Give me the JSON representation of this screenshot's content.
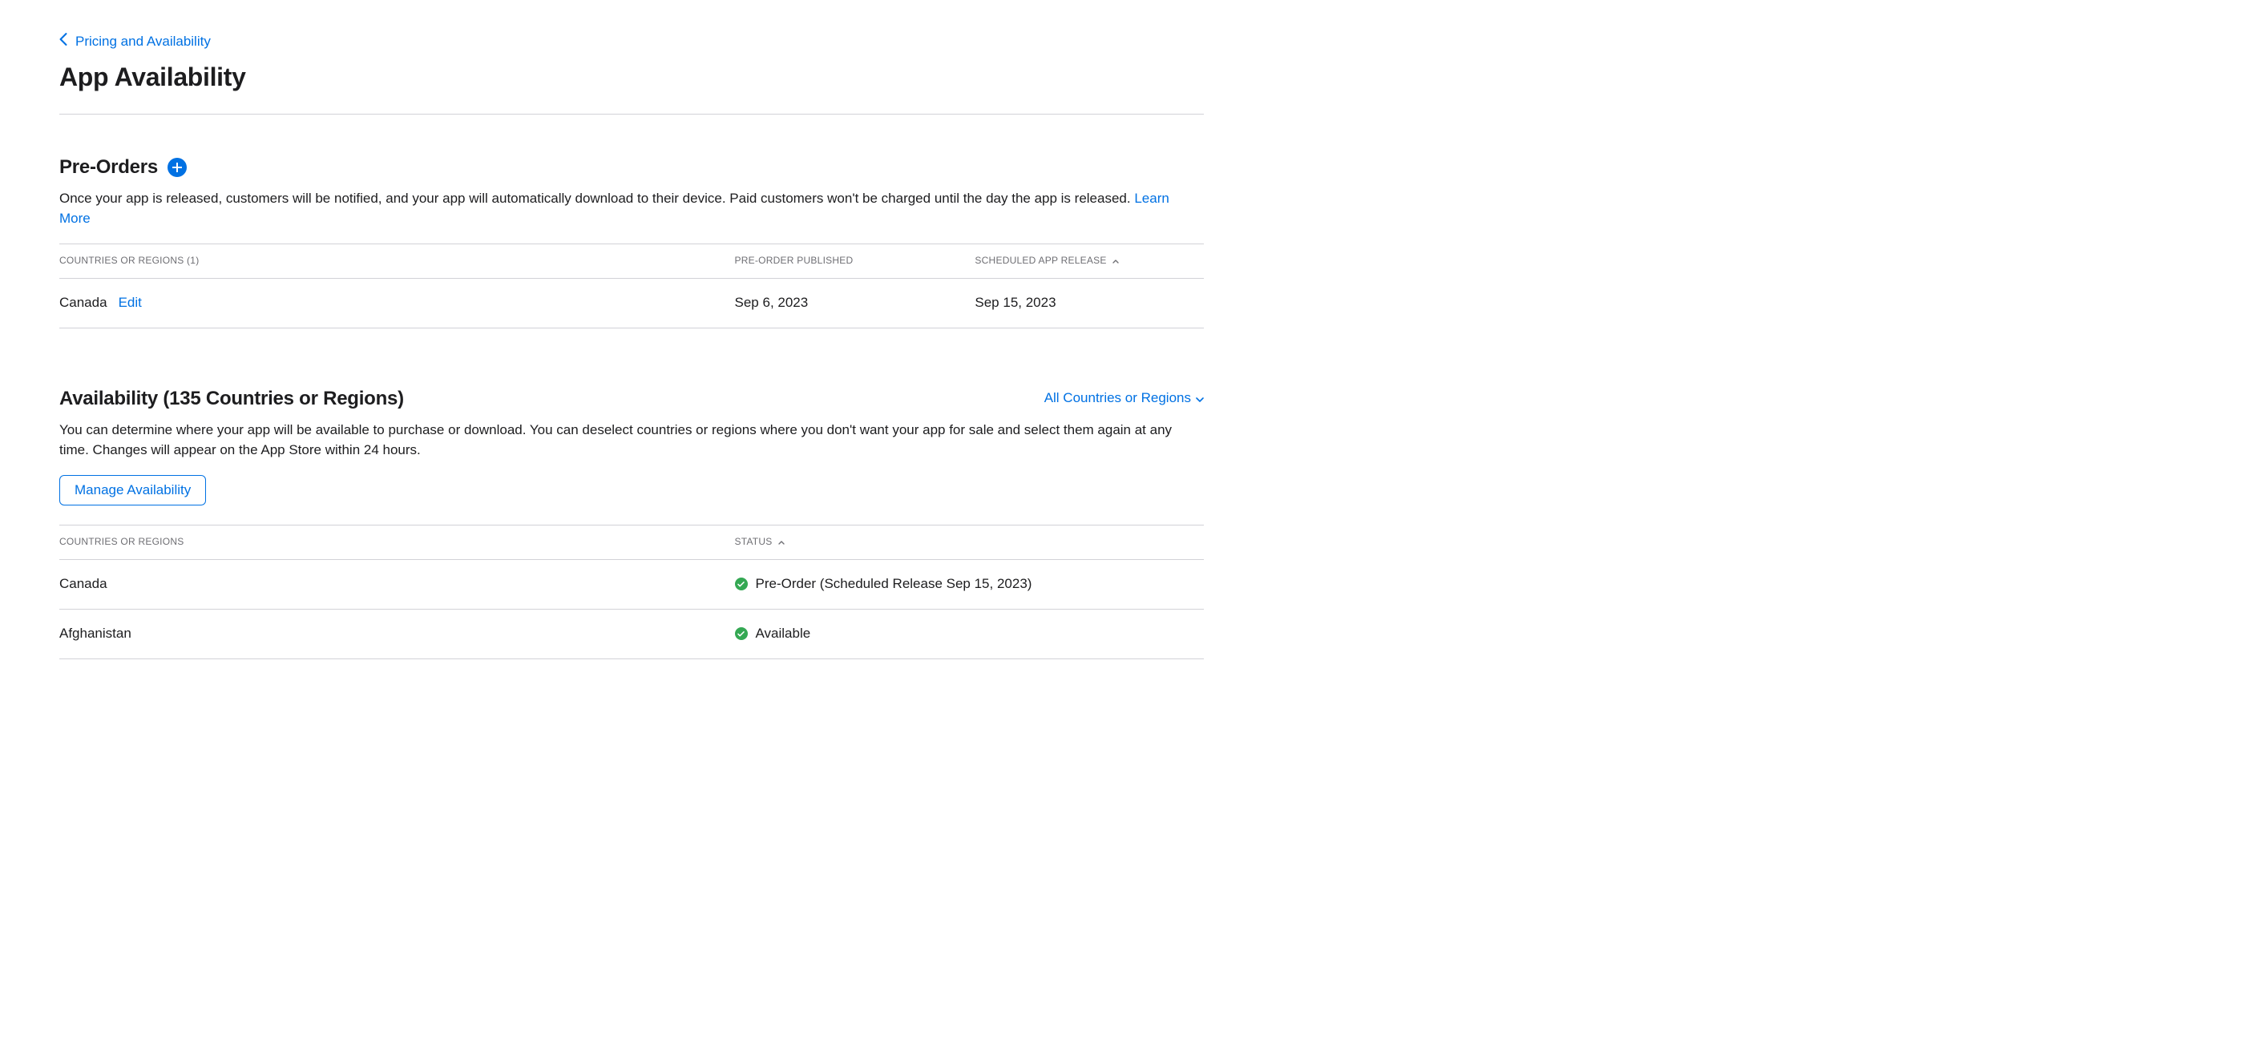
{
  "breadcrumb": {
    "label": "Pricing and Availability"
  },
  "page_title": "App Availability",
  "preorders": {
    "title": "Pre-Orders",
    "description": "Once your app is released, customers will be notified, and your app will automatically download to their device. Paid customers won't be charged until the day the app is released. ",
    "learn_more": "Learn More",
    "table": {
      "headers": {
        "countries": "Countries or Regions (1)",
        "published": "Pre-Order Published",
        "release": "Scheduled App Release"
      },
      "rows": [
        {
          "country": "Canada",
          "edit_label": "Edit",
          "published": "Sep 6, 2023",
          "release": "Sep 15, 2023"
        }
      ]
    }
  },
  "availability": {
    "title": "Availability (135 Countries or Regions)",
    "filter_label": "All Countries or Regions",
    "description": "You can determine where your app will be available to purchase or download. You can deselect countries or regions where you don't want your app for sale and select them again at any time. Changes will appear on the App Store within 24 hours.",
    "manage_button": "Manage Availability",
    "table": {
      "headers": {
        "countries": "Countries or Regions",
        "status": "Status"
      },
      "rows": [
        {
          "country": "Canada",
          "status": "Pre-Order (Scheduled Release Sep 15, 2023)"
        },
        {
          "country": "Afghanistan",
          "status": "Available"
        }
      ]
    }
  }
}
